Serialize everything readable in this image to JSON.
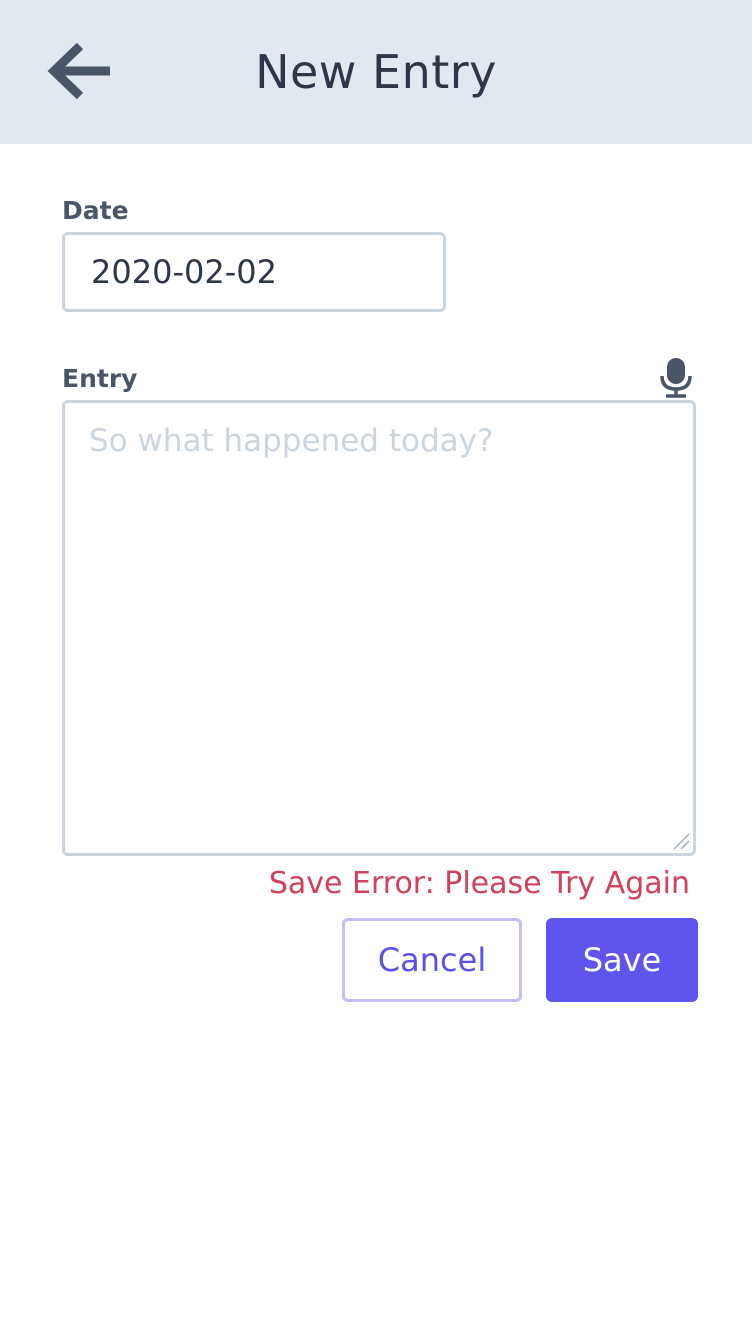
{
  "header": {
    "title": "New Entry",
    "back_icon": "arrow-left-icon"
  },
  "form": {
    "date_label": "Date",
    "date_value": "2020-02-02",
    "entry_label": "Entry",
    "entry_placeholder": "So what happened today?",
    "entry_value": "",
    "mic_icon": "microphone-icon"
  },
  "status": {
    "error_text": "Save Error: Please Try Again",
    "error_color": "#d0415b"
  },
  "actions": {
    "cancel_label": "Cancel",
    "save_label": "Save",
    "accent_color": "#5f55ee"
  }
}
